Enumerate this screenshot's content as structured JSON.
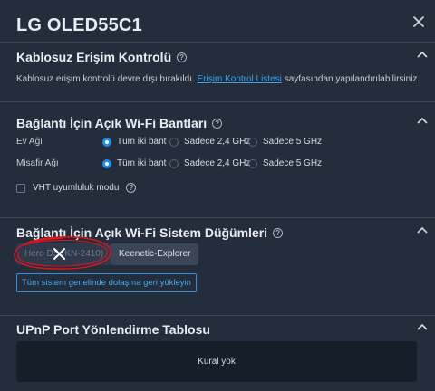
{
  "window": {
    "title": "LG OLED55C1"
  },
  "wireless_access": {
    "title": "Kablosuz Erişim Kontrolü",
    "desc_prefix": "Kablosuz erişim kontrolü devre dışı bırakıldı.",
    "link": "Erişim Kontrol Listesi",
    "desc_suffix": "sayfasından yapılandırılabilirsiniz."
  },
  "bands": {
    "title": "Bağlantı İçin Açık Wi-Fi Bantları",
    "rows": [
      {
        "label": "Ev Ağı",
        "options": [
          "Tüm iki bant",
          "Sadece 2,4 GHz",
          "Sadece 5 GHz"
        ],
        "selected": 0
      },
      {
        "label": "Misafir Ağı",
        "options": [
          "Tüm iki bant",
          "Sadece 2,4 GHz",
          "Sadece 5 GHz"
        ],
        "selected": 0
      }
    ],
    "vht_label": "VHT uyumluluk modu"
  },
  "nodes": {
    "title": "Bağlantı İçin Açık Wi-Fi Sistem Düğümleri",
    "items": [
      "Hero DS (KN-2410)",
      "Keenetic-Explorer"
    ],
    "reset_label": "Tüm sistem genelinde dolaşma geri yükleyin"
  },
  "upnp": {
    "title": "UPnP Port Yönlendirme Tablosu",
    "empty_text": "Kural yok"
  },
  "colors": {
    "accent": "#1e8ee8",
    "link": "#3ea0ec",
    "annotation": "#e0141e"
  }
}
